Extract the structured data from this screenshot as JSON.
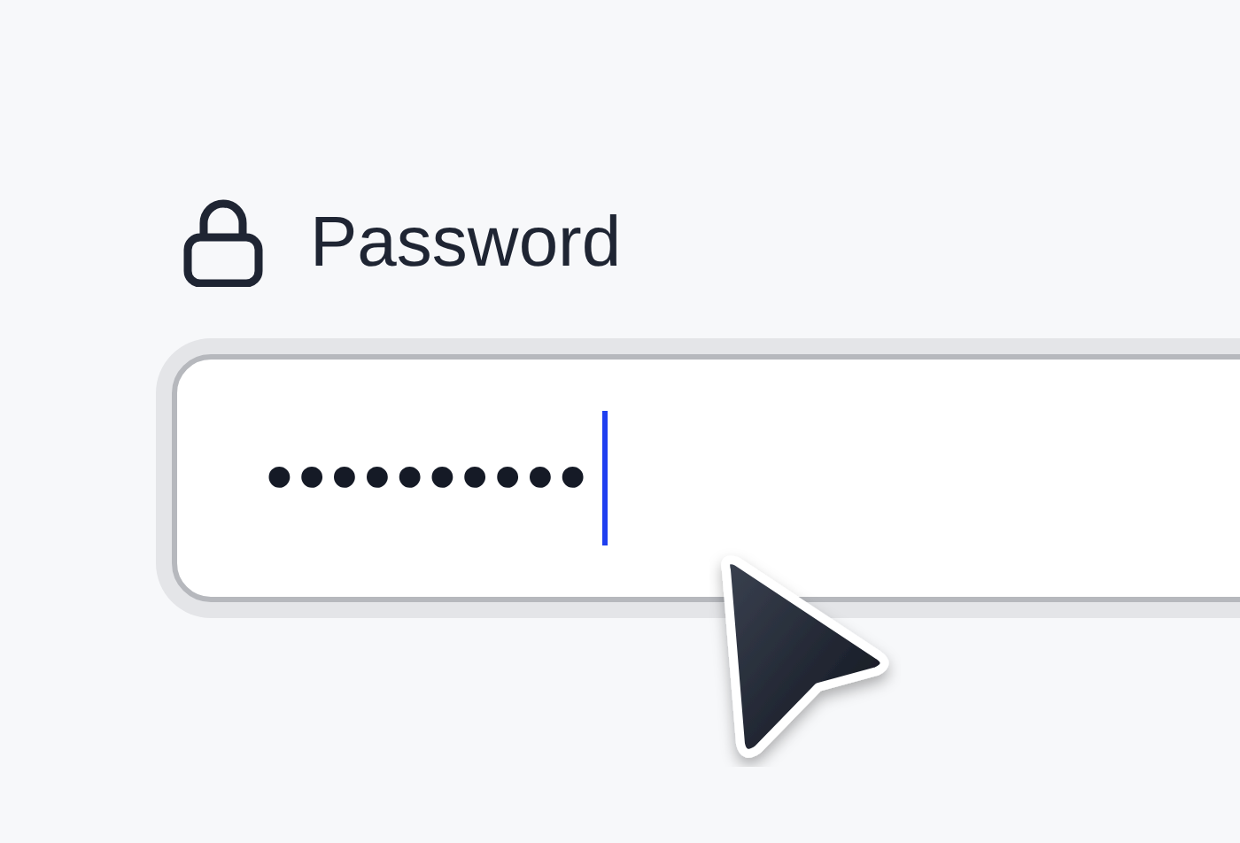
{
  "password_field": {
    "label": "Password",
    "value": "••••••••••",
    "focused": true
  }
}
